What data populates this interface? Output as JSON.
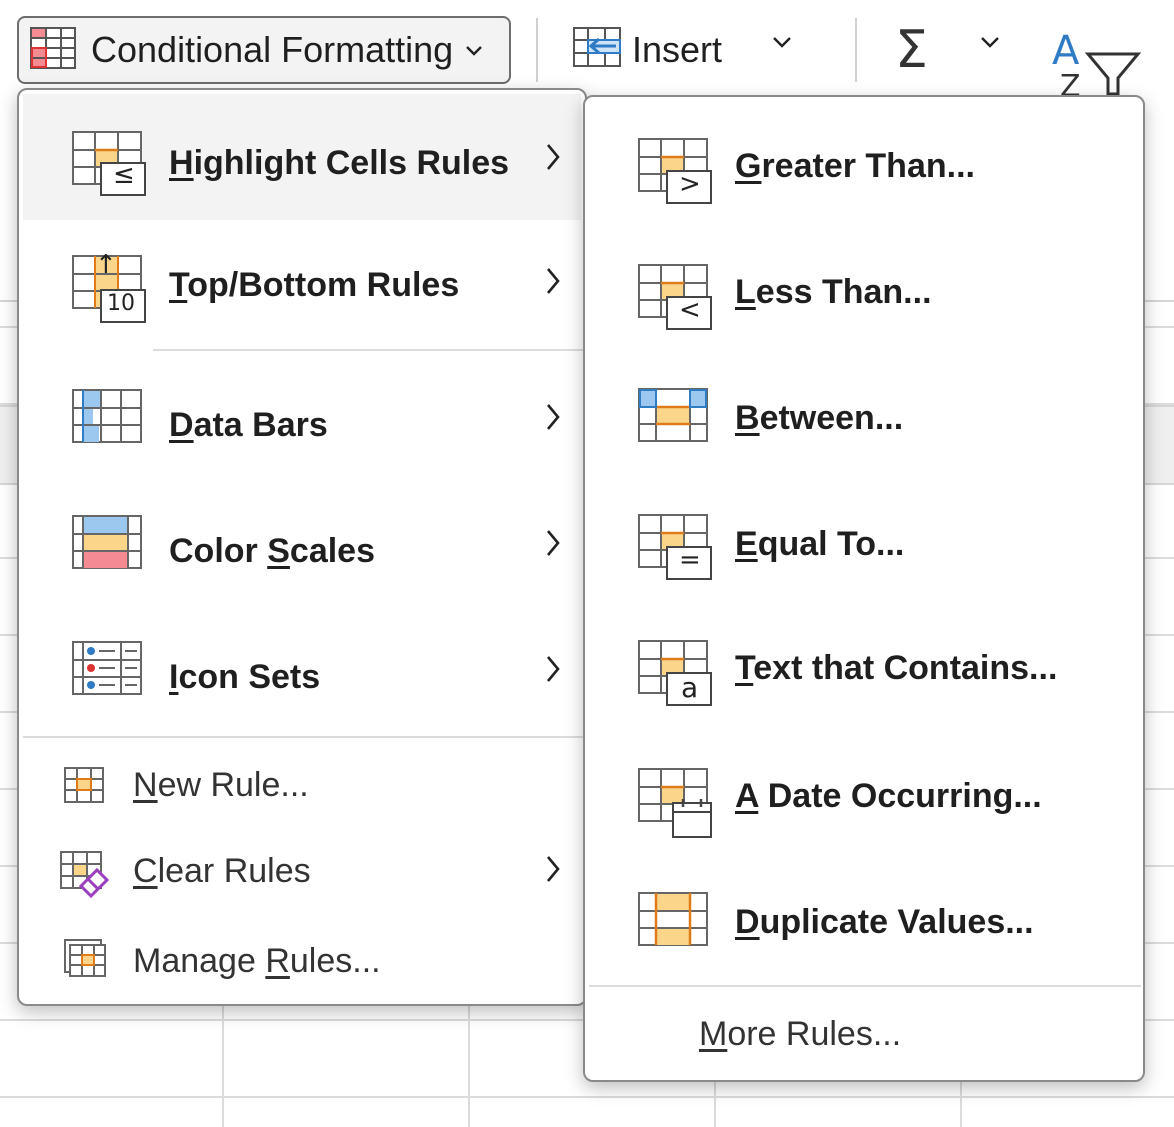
{
  "ribbon": {
    "conditional_formatting": "Conditional Formatting",
    "insert": "Insert",
    "sum_symbol": "Σ"
  },
  "main_menu": {
    "items": [
      {
        "pre": "",
        "u": "H",
        "post": "ighlight Cells Rules"
      },
      {
        "pre": "",
        "u": "T",
        "post": "op/Bottom Rules"
      },
      {
        "pre": "",
        "u": "D",
        "post": "ata Bars"
      },
      {
        "pre": "Color ",
        "u": "S",
        "post": "cales"
      },
      {
        "pre": "",
        "u": "I",
        "post": "con Sets"
      },
      {
        "pre": "",
        "u": "N",
        "post": "ew Rule..."
      },
      {
        "pre": "",
        "u": "C",
        "post": "lear Rules"
      },
      {
        "pre": "Manage ",
        "u": "R",
        "post": "ules..."
      }
    ]
  },
  "sub_menu": {
    "items": [
      {
        "pre": "",
        "u": "G",
        "post": "reater Than..."
      },
      {
        "pre": "",
        "u": "L",
        "post": "ess Than..."
      },
      {
        "pre": "",
        "u": "B",
        "post": "etween..."
      },
      {
        "pre": "",
        "u": "E",
        "post": "qual To..."
      },
      {
        "pre": "",
        "u": "T",
        "post": "ext that Contains..."
      },
      {
        "pre": "",
        "u": "A",
        "post": " Date Occurring..."
      },
      {
        "pre": "",
        "u": "D",
        "post": "uplicate Values..."
      }
    ],
    "more_rules": {
      "pre": "",
      "u": "M",
      "post": "ore Rules..."
    }
  },
  "icon_glyphs": {
    "less_equal": "≤",
    "greater": ">",
    "less": "<",
    "equal": "=",
    "text_a": "a",
    "top_ten": "10",
    "up_arrow": "↑"
  },
  "colors": {
    "orange_fill": "#fbd68a",
    "orange_line": "#e07b1a",
    "blue_fill": "#9cc7ef",
    "blue_line": "#2f7bc4",
    "red_fill": "#f48b92",
    "purple": "#9b3fbf"
  }
}
